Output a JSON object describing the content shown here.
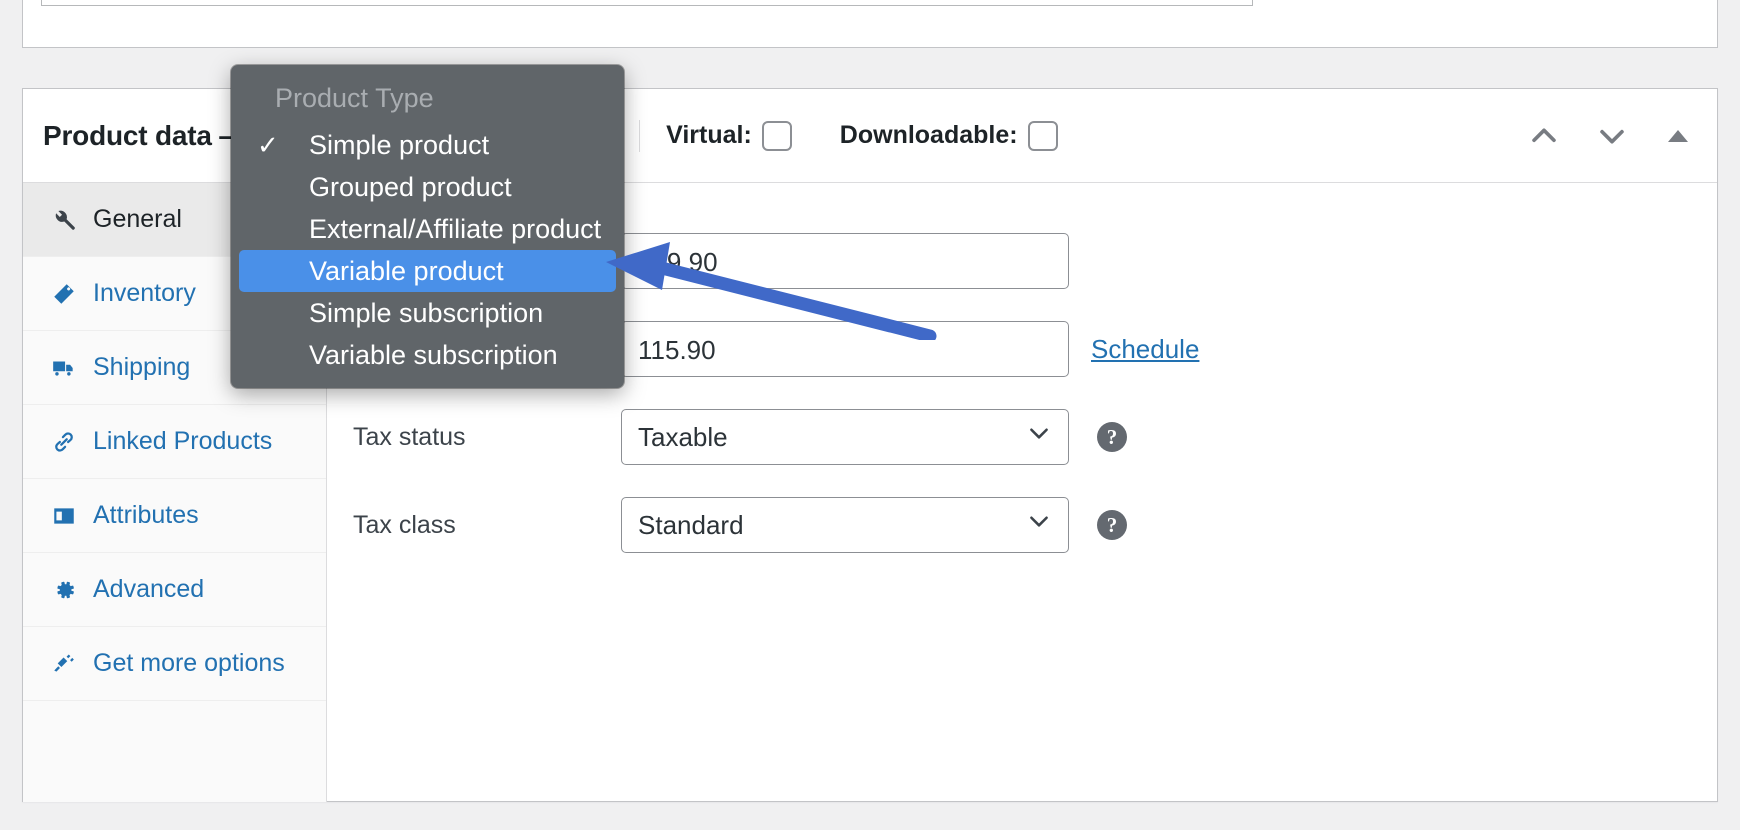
{
  "metabox": {
    "title": "Product data —",
    "help_icon": "help-icon",
    "virtual": {
      "label": "Virtual:",
      "checked": false
    },
    "downloadable": {
      "label": "Downloadable:",
      "checked": false
    },
    "actions": {
      "move_up": "chevron-up-icon",
      "move_down": "chevron-down-icon",
      "toggle": "triangle-up-icon"
    }
  },
  "product_type_select": {
    "selected": "Simple product",
    "focused": true
  },
  "dropdown": {
    "header": "Product Type",
    "items": [
      {
        "label": "Simple product",
        "checked": true,
        "highlighted": false
      },
      {
        "label": "Grouped product",
        "checked": false,
        "highlighted": false
      },
      {
        "label": "External/Affiliate product",
        "checked": false,
        "highlighted": false
      },
      {
        "label": "Variable product",
        "checked": false,
        "highlighted": true
      },
      {
        "label": "Simple subscription",
        "checked": false,
        "highlighted": false
      },
      {
        "label": "Variable subscription",
        "checked": false,
        "highlighted": false
      }
    ],
    "check_glyph": "✓",
    "highlight_color": "#4a90e8",
    "background_color": "#606569"
  },
  "tabs": [
    {
      "label": "General",
      "icon": "wrench-icon",
      "active": true
    },
    {
      "label": "Inventory",
      "icon": "inventory-tag-icon",
      "active": false
    },
    {
      "label": "Shipping",
      "icon": "truck-icon",
      "active": false
    },
    {
      "label": "Linked Products",
      "icon": "link-icon",
      "active": false
    },
    {
      "label": "Attributes",
      "icon": "list-card-icon",
      "active": false
    },
    {
      "label": "Advanced",
      "icon": "gear-icon",
      "active": false
    },
    {
      "label": "Get more options",
      "icon": "plug-icon",
      "active": false
    }
  ],
  "general_panel": {
    "regular_price": {
      "label": "",
      "value": "149.90"
    },
    "sale_price": {
      "label": "",
      "value": "115.90",
      "schedule_link": "Schedule"
    },
    "tax_status": {
      "label": "Tax status",
      "value": "Taxable"
    },
    "tax_class": {
      "label": "Tax class",
      "value": "Standard"
    }
  },
  "annotation": {
    "type": "arrow",
    "color": "#4069c8",
    "points_to": "Variable product"
  },
  "colors": {
    "link": "#2271b1",
    "focus_border": "#2271b1",
    "panel_bg": "#ffffff",
    "page_bg": "#f0f0f1",
    "tab_bg": "#fafafa",
    "tab_active_bg": "#eaeaea"
  }
}
